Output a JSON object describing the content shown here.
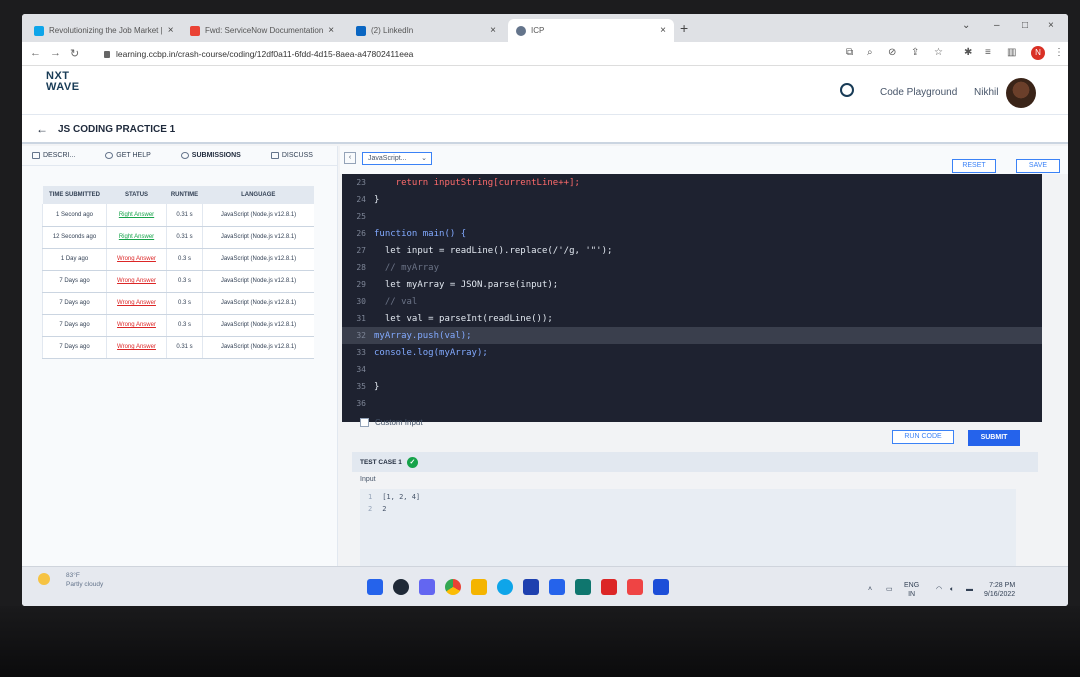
{
  "browser": {
    "tabs": [
      {
        "title": "Revolutionizing the Job Market |",
        "favicon_color": "#0ea5e9"
      },
      {
        "title": "Fwd: ServiceNow Documentation",
        "favicon_color": "#ea4335"
      },
      {
        "title": "(2) LinkedIn",
        "favicon_color": "#0a66c2"
      },
      {
        "title": "ICP",
        "favicon_color": "#64748b"
      }
    ],
    "new_tab": "+",
    "url": "learning.ccbp.in/crash-course/coding/12df0a11-6fdd-4d15-8aea-a47802411eea",
    "profile_initial": "N"
  },
  "app": {
    "logo_line1": "NXT",
    "logo_line2": "WAVE",
    "code_playground": "Code Playground",
    "user_name": "Nikhil",
    "page_title": "JS CODING PRACTICE 1"
  },
  "left_tabs": [
    {
      "label": "DESCRI..."
    },
    {
      "label": "GET HELP"
    },
    {
      "label": "SUBMISSIONS"
    },
    {
      "label": "DISCUSS"
    }
  ],
  "submissions": {
    "columns": [
      "TIME SUBMITTED",
      "STATUS",
      "RUNTIME",
      "LANGUAGE"
    ],
    "rows": [
      {
        "time": "1 Second ago",
        "status": "Right Answer",
        "runtime": "0.31 s",
        "language": "JavaScript (Node.js v12.8.1)"
      },
      {
        "time": "12 Seconds ago",
        "status": "Right Answer",
        "runtime": "0.31 s",
        "language": "JavaScript (Node.js v12.8.1)"
      },
      {
        "time": "1 Day ago",
        "status": "Wrong Answer",
        "runtime": "0.3 s",
        "language": "JavaScript (Node.js v12.8.1)"
      },
      {
        "time": "7 Days ago",
        "status": "Wrong Answer",
        "runtime": "0.3 s",
        "language": "JavaScript (Node.js v12.8.1)"
      },
      {
        "time": "7 Days ago",
        "status": "Wrong Answer",
        "runtime": "0.3 s",
        "language": "JavaScript (Node.js v12.8.1)"
      },
      {
        "time": "7 Days ago",
        "status": "Wrong Answer",
        "runtime": "0.3 s",
        "language": "JavaScript (Node.js v12.8.1)"
      },
      {
        "time": "7 Days ago",
        "status": "Wrong Answer",
        "runtime": "0.31 s",
        "language": "JavaScript (Node.js v12.8.1)"
      }
    ]
  },
  "editor": {
    "language": "JavaScript...",
    "reset_label": "RESET",
    "save_label": "SAVE",
    "lines": [
      {
        "num": "23",
        "text": "    return inputString[currentLine++];"
      },
      {
        "num": "24",
        "text": "}"
      },
      {
        "num": "25",
        "text": ""
      },
      {
        "num": "26",
        "text": "function main() {"
      },
      {
        "num": "27",
        "text": "  let input = readLine().replace(/'/g, '\"');"
      },
      {
        "num": "28",
        "text": "  // myArray"
      },
      {
        "num": "29",
        "text": "  let myArray = JSON.parse(input);"
      },
      {
        "num": "30",
        "text": "  // val"
      },
      {
        "num": "31",
        "text": "  let val = parseInt(readLine());"
      },
      {
        "num": "32",
        "text": "myArray.push(val);"
      },
      {
        "num": "33",
        "text": "console.log(myArray);"
      },
      {
        "num": "34",
        "text": ""
      },
      {
        "num": "35",
        "text": "}"
      },
      {
        "num": "36",
        "text": ""
      }
    ],
    "highlighted_line": "32"
  },
  "console": {
    "custom_input_label": "Custom Input",
    "run_code_label": "RUN CODE",
    "submit_label": "SUBMIT",
    "test_case_label": "TEST CASE 1",
    "input_label": "Input",
    "input_lines": [
      {
        "num": "1",
        "text": "[1, 2, 4]"
      },
      {
        "num": "2",
        "text": "2"
      }
    ]
  },
  "taskbar": {
    "weather_temp": "83°F",
    "weather_desc": "Partly cloudy",
    "lang_line1": "ENG",
    "lang_line2": "IN",
    "time": "7:28 PM",
    "date": "9/16/2022"
  }
}
